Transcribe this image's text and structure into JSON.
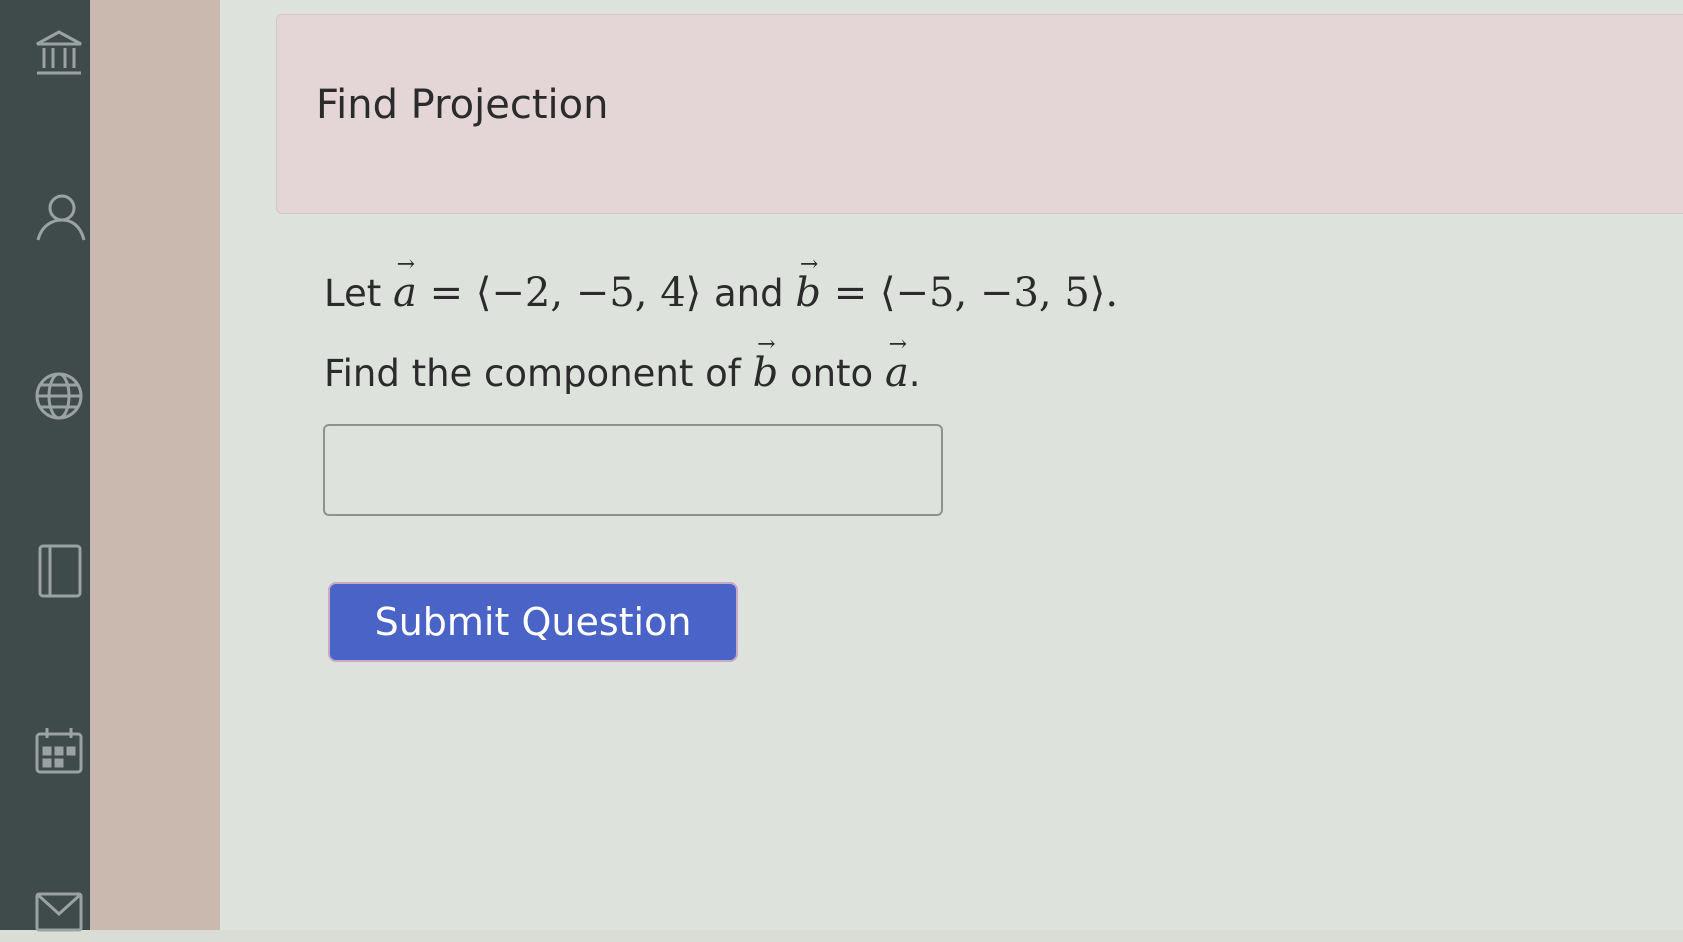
{
  "sidebar": {
    "icons": [
      "institution-icon",
      "user-icon",
      "globe-icon",
      "book-icon",
      "calendar-icon",
      "mail-icon"
    ]
  },
  "header": {
    "title": "Find Projection"
  },
  "question": {
    "let_label": "Let",
    "vec_a_symbol": "a",
    "vec_a_value": "= ⟨−2, −5, 4⟩",
    "and_label": "and",
    "vec_b_symbol": "b",
    "vec_b_value": "= ⟨−5, −3, 5⟩.",
    "prompt_prefix": "Find the component of",
    "prompt_vec_b": "b",
    "prompt_mid": "onto",
    "prompt_vec_a": "a",
    "prompt_end": "."
  },
  "answer": {
    "value": ""
  },
  "actions": {
    "submit_label": "Submit Question"
  },
  "colors": {
    "sidebar": "#3f4a4a",
    "header_bg": "#e4d6d7",
    "submit_bg": "#4a63c7"
  }
}
